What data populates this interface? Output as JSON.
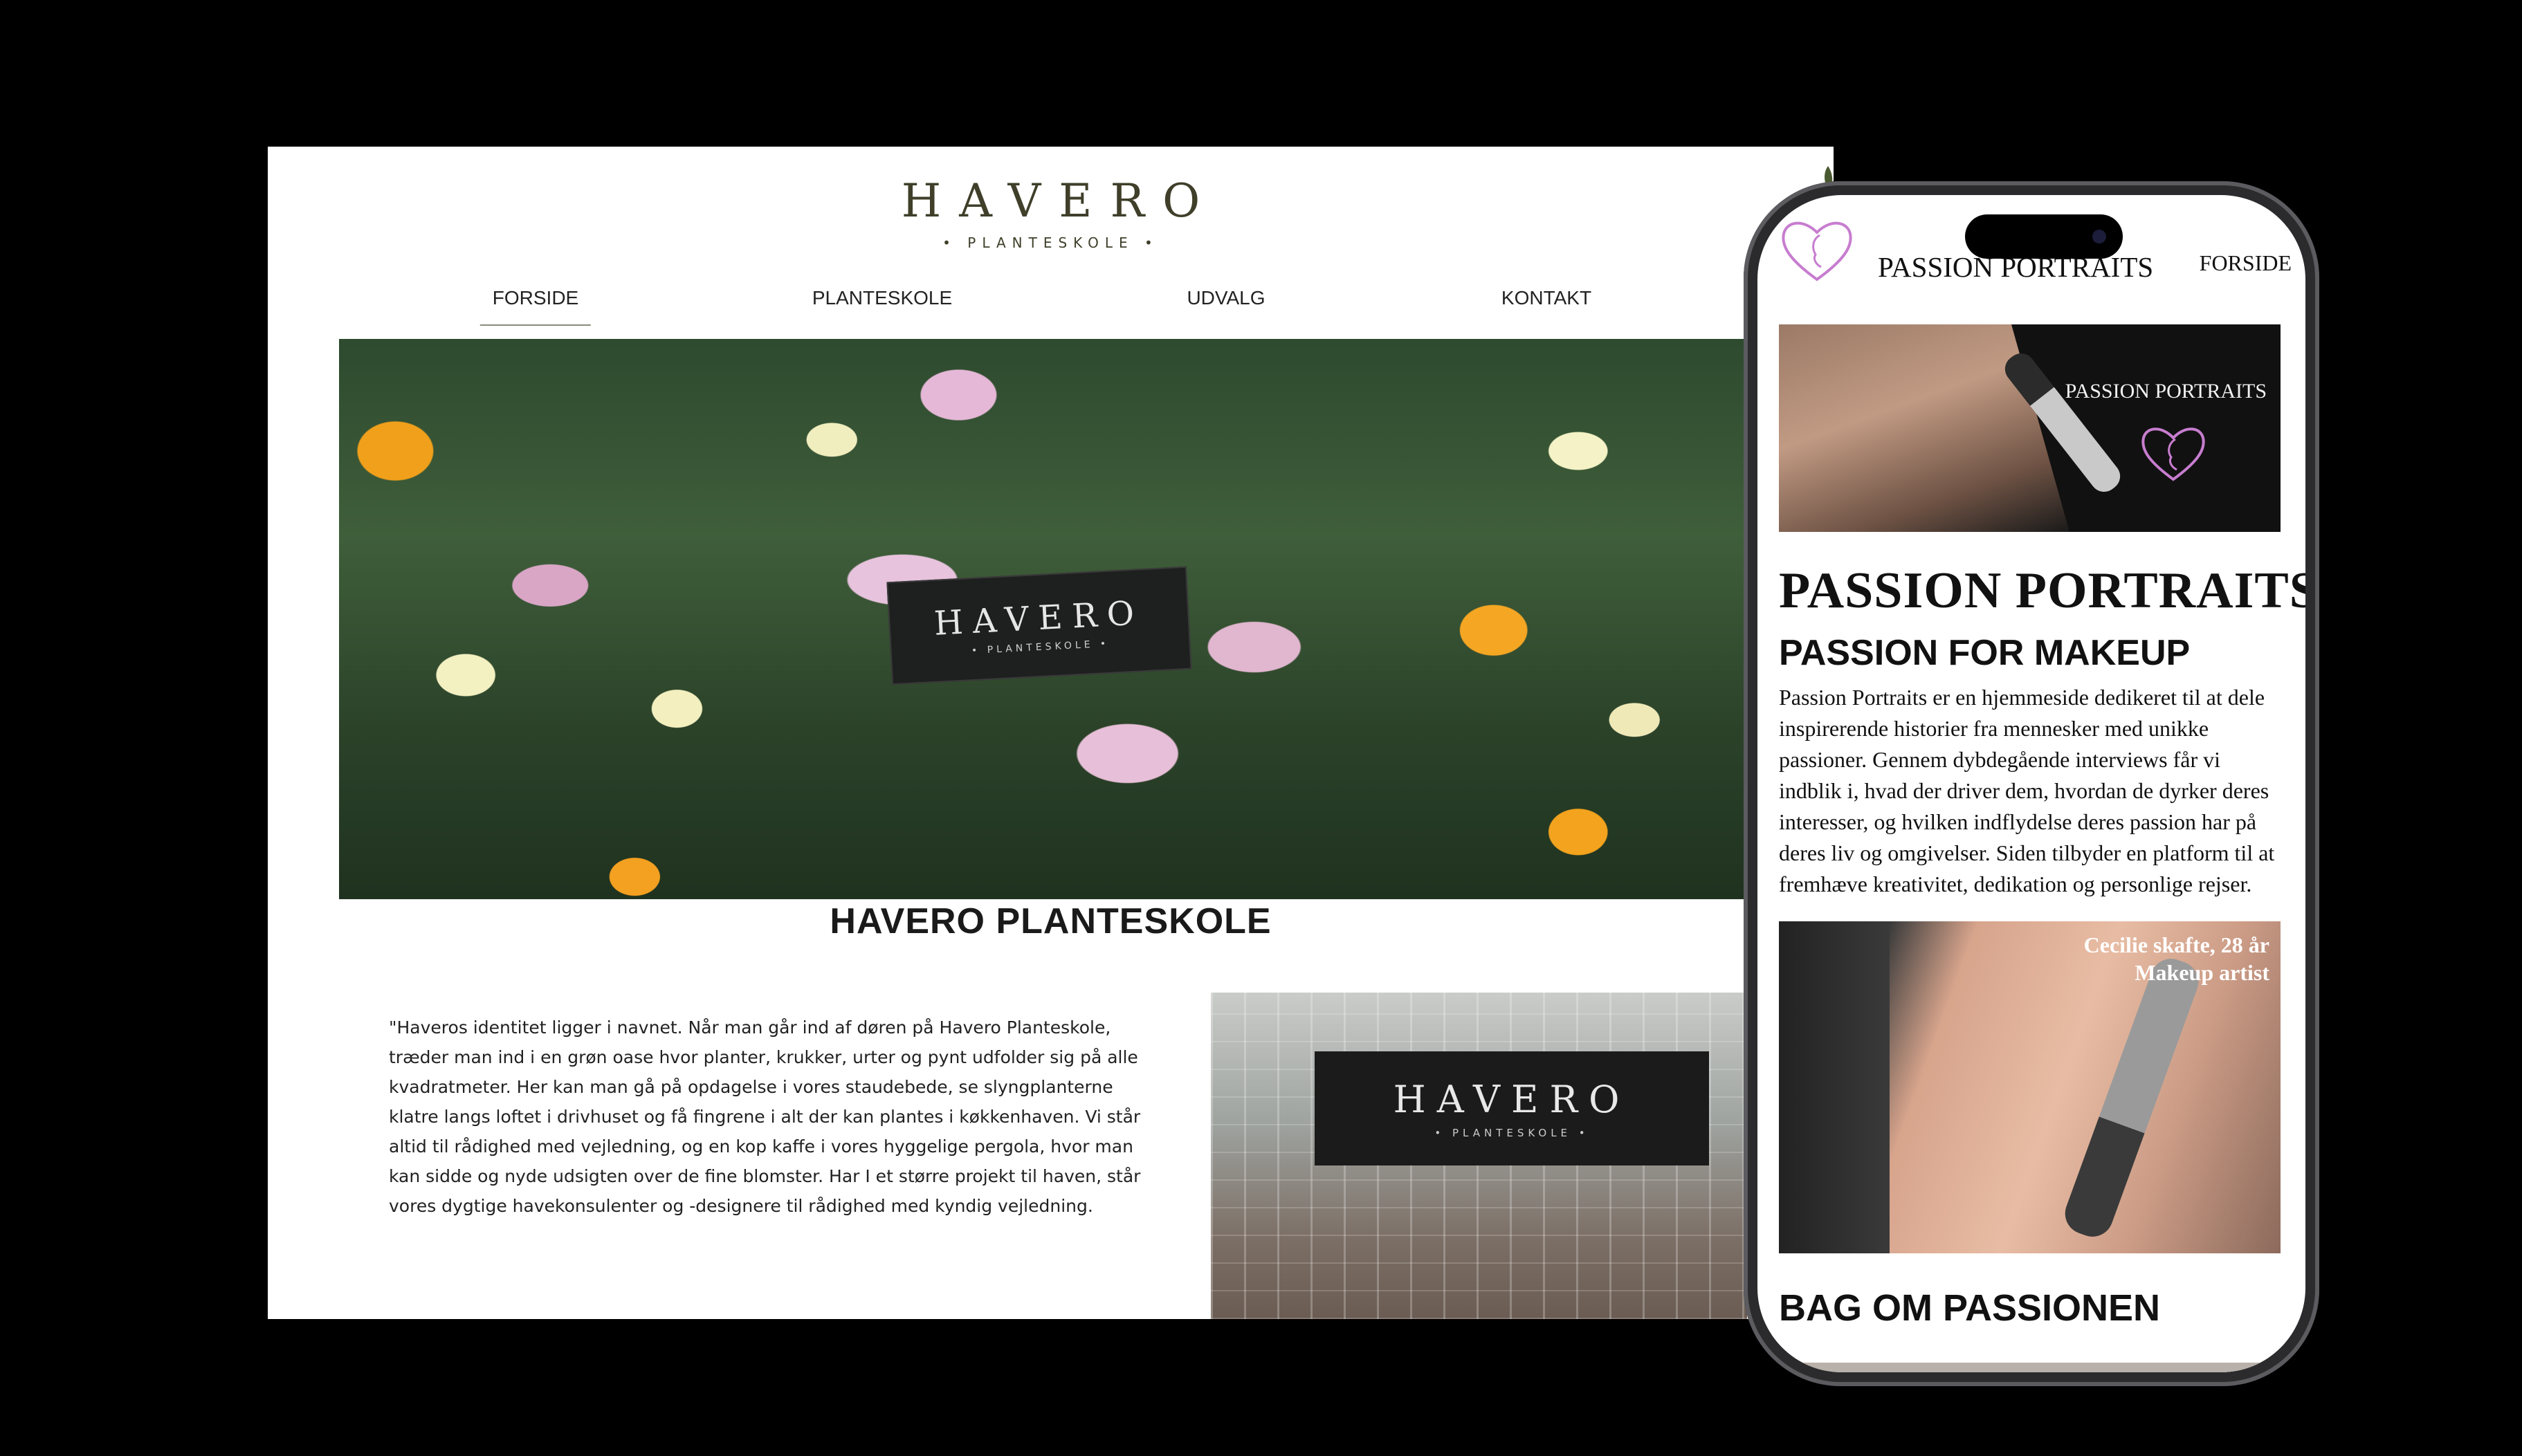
{
  "desktop": {
    "logo": {
      "word": "HAVERO",
      "subtitle": "• PLANTESKOLE •"
    },
    "nav": [
      {
        "label": "FORSIDE",
        "active": true
      },
      {
        "label": "PLANTESKOLE",
        "active": false
      },
      {
        "label": "UDVALG",
        "active": false
      },
      {
        "label": "KONTAKT",
        "active": false
      }
    ],
    "hero_sign": {
      "word": "HAVERO",
      "subtitle": "• PLANTESKOLE •"
    },
    "heading": "HAVERO PLANTESKOLE",
    "intro": "\"Haveros identitet ligger i navnet. Når man går ind af døren på Havero Planteskole, træder man ind i en grøn oase hvor planter, krukker, urter og pynt udfolder sig på alle kvadratmeter. Her kan man gå på opdagelse i vores staudebede, se slyngplanterne klatre langs loftet i drivhuset og få fingrene i alt der kan plantes i køkkenhaven. Vi står altid til rådighed med vejledning, og en kop kaffe i vores hyggelige pergola, hvor man kan sidde og nyde udsigten over de fine blomster. Har I et større projekt til haven, står vores dygtige havekonsulenter og -designere til rådighed med kyndig vejledning.",
    "greenhouse_sign": {
      "word": "HAVERO",
      "subtitle": "• PLANTESKOLE •"
    },
    "colors": {
      "logo": "#3f3f2a",
      "background": "#ffffff"
    }
  },
  "mobile": {
    "header": {
      "brand": "PASSION PORTRAITS",
      "nav": "FORSIDE",
      "logo_icon": "heart-face-logo-icon"
    },
    "banner": {
      "title": "PASSION PORTRAITS",
      "icon": "heart-face-logo-icon"
    },
    "h1": "PASSION PORTRAITS",
    "h2": "PASSION FOR MAKEUP",
    "body": "Passion Portraits er en hjemmeside dedikeret til at dele inspirerende historier fra mennesker med unikke passioner. Gennem dybdegående interviews får vi indblik i, hvad der driver dem, hvordan de dyrker deres interesser, og hvilken indflydelse deres passion har på deres liv og omgivelser. Siden tilbyder en platform til at fremhæve kreativitet, dedikation og personlige rejser.",
    "photo_caption": {
      "line1": "Cecilie skafte, 28 år",
      "line2": "Makeup artist"
    },
    "h3": "BAG OM PASSIONEN",
    "colors": {
      "accent": "#c77dcf",
      "background": "#ffffff",
      "frame": "#2b2b2d"
    }
  }
}
